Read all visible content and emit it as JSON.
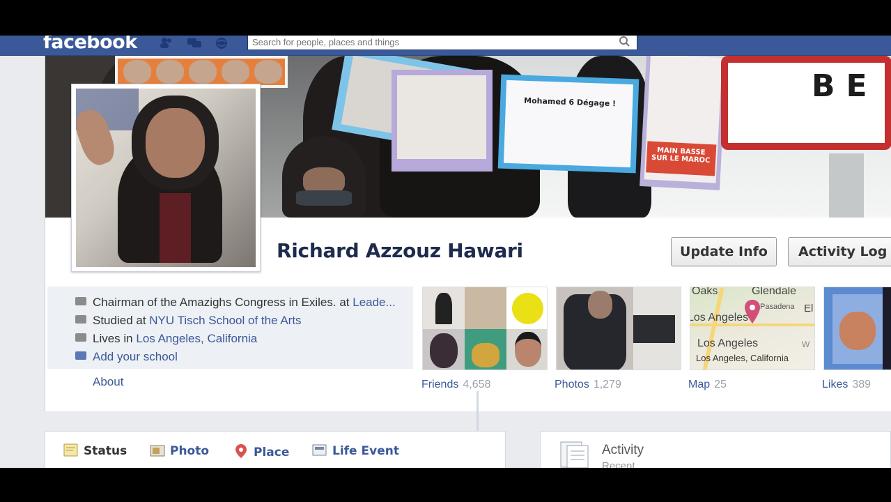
{
  "topbar": {
    "logo": "facebook",
    "search_placeholder": "Search for people, places and things"
  },
  "cover": {
    "sign_text": "BE",
    "placard_text": "Mohamed 6 Dégage !",
    "placard_red_text": "MAIN BASSE SUR LE MAROC"
  },
  "profile": {
    "name": "Richard Azzouz Hawari",
    "actions": {
      "update_info": "Update Info",
      "activity_log": "Activity Log"
    },
    "info": {
      "work_prefix": "Chairman of the Amazighs Congress in Exiles. at ",
      "work_link": "Leade...",
      "study_prefix": "Studied at ",
      "study_link": "NYU Tisch School of the Arts",
      "lives_prefix": "Lives in ",
      "lives_link": "Los Angeles, California",
      "add_school": "Add your school"
    },
    "about": "About",
    "tiles": [
      {
        "label": "Friends",
        "count": "4,658"
      },
      {
        "label": "Photos",
        "count": "1,279"
      },
      {
        "label": "Map",
        "count": "25"
      },
      {
        "label": "Likes",
        "count": "389"
      }
    ],
    "map": {
      "places": [
        "Oaks",
        "Glendale",
        "Pasadena",
        "El",
        "Los Angeles",
        "Los Angeles",
        "Los Angeles, California",
        "W"
      ]
    }
  },
  "composer": {
    "tabs": [
      "Status",
      "Photo",
      "Place",
      "Life Event"
    ]
  },
  "activity": {
    "title": "Activity",
    "subtitle": "Recent"
  },
  "colors": {
    "brand_blue": "#3b5998",
    "link_blue": "#3b5998",
    "name_color": "#1e2b4d"
  }
}
